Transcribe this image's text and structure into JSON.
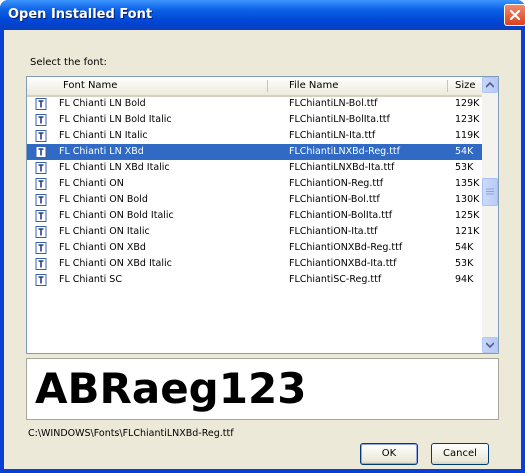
{
  "window": {
    "title": "Open Installed Font"
  },
  "dialog": {
    "select_label": "Select the font:",
    "columns": {
      "name": "Font Name",
      "file": "File Name",
      "size": "Size"
    },
    "rows": [
      {
        "name": "FL Chianti LN Bold",
        "file": "FLChiantiLN-Bol.ttf",
        "size": "129K",
        "selected": false
      },
      {
        "name": "FL Chianti LN Bold Italic",
        "file": "FLChiantiLN-BolIta.ttf",
        "size": "123K",
        "selected": false
      },
      {
        "name": "FL Chianti LN Italic",
        "file": "FLChiantiLN-Ita.ttf",
        "size": "119K",
        "selected": false
      },
      {
        "name": "FL Chianti LN XBd",
        "file": "FLChiantiLNXBd-Reg.ttf",
        "size": "54K",
        "selected": true
      },
      {
        "name": "FL Chianti LN XBd Italic",
        "file": "FLChiantiLNXBd-Ita.ttf",
        "size": "53K",
        "selected": false
      },
      {
        "name": "FL Chianti ON",
        "file": "FLChiantiON-Reg.ttf",
        "size": "135K",
        "selected": false
      },
      {
        "name": "FL Chianti ON Bold",
        "file": "FLChiantiON-Bol.ttf",
        "size": "130K",
        "selected": false
      },
      {
        "name": "FL Chianti ON Bold Italic",
        "file": "FLChiantiON-BolIta.ttf",
        "size": "125K",
        "selected": false
      },
      {
        "name": "FL Chianti ON Italic",
        "file": "FLChiantiON-Ita.ttf",
        "size": "121K",
        "selected": false
      },
      {
        "name": "FL Chianti ON XBd",
        "file": "FLChiantiONXBd-Reg.ttf",
        "size": "54K",
        "selected": false
      },
      {
        "name": "FL Chianti ON XBd Italic",
        "file": "FLChiantiONXBd-Ita.ttf",
        "size": "53K",
        "selected": false
      },
      {
        "name": "FL Chianti SC",
        "file": "FLChiantiSC-Reg.ttf",
        "size": "94K",
        "selected": false
      }
    ],
    "preview_text": "ABRaeg123",
    "path": "C:\\WINDOWS\\Fonts\\FLChiantiLNXBd-Reg.ttf",
    "ok_label": "OK",
    "cancel_label": "Cancel"
  },
  "icons": {
    "close": "close-icon",
    "font_file": "font-file-icon",
    "scroll_up": "scroll-up-arrow-icon",
    "scroll_down": "scroll-down-arrow-icon"
  },
  "colors": {
    "titlebar": "#0a5fe6",
    "selection": "#316ac5",
    "close_button": "#d9411d",
    "dialog_face": "#ece9d8"
  }
}
